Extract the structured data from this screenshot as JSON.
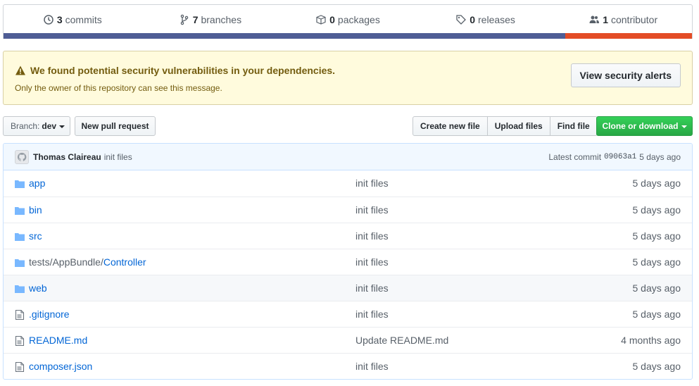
{
  "summary": {
    "items": [
      {
        "count": "3",
        "label": "commits",
        "icon": "history-icon"
      },
      {
        "count": "7",
        "label": "branches",
        "icon": "git-branch-icon"
      },
      {
        "count": "0",
        "label": "packages",
        "icon": "package-icon"
      },
      {
        "count": "0",
        "label": "releases",
        "icon": "tag-icon"
      },
      {
        "count": "1",
        "label": "contributor",
        "icon": "people-icon"
      }
    ],
    "languages": [
      {
        "color": "#4f5d95",
        "share": 0.816
      },
      {
        "color": "#e34c26",
        "share": 0.184
      }
    ]
  },
  "alert": {
    "title": "We found potential security vulnerabilities in your dependencies.",
    "subtitle": "Only the owner of this repository can see this message.",
    "button": "View security alerts",
    "icon": "alert-icon"
  },
  "toolbar": {
    "branch_prefix": "Branch:",
    "branch_name": "dev",
    "new_pr": "New pull request",
    "create_file": "Create new file",
    "upload_files": "Upload files",
    "find_file": "Find file",
    "clone": "Clone or download"
  },
  "commit": {
    "author": "Thomas Claireau",
    "message": "init files",
    "latest_label": "Latest commit",
    "sha": "09063a1",
    "age": "5 days ago"
  },
  "files": [
    {
      "type": "dir",
      "name": "app",
      "message": "init files",
      "age": "5 days ago"
    },
    {
      "type": "dir",
      "name": "bin",
      "message": "init files",
      "age": "5 days ago"
    },
    {
      "type": "dir",
      "name": "src",
      "message": "init files",
      "age": "5 days ago"
    },
    {
      "type": "dir",
      "prefix": "tests/AppBundle/",
      "name": "Controller",
      "message": "init files",
      "age": "5 days ago"
    },
    {
      "type": "dir",
      "name": "web",
      "message": "init files",
      "age": "5 days ago"
    },
    {
      "type": "file",
      "name": ".gitignore",
      "message": "init files",
      "age": "5 days ago"
    },
    {
      "type": "file",
      "name": "README.md",
      "message": "Update README.md",
      "age": "4 months ago"
    },
    {
      "type": "file",
      "name": "composer.json",
      "message": "init files",
      "age": "5 days ago"
    }
  ]
}
